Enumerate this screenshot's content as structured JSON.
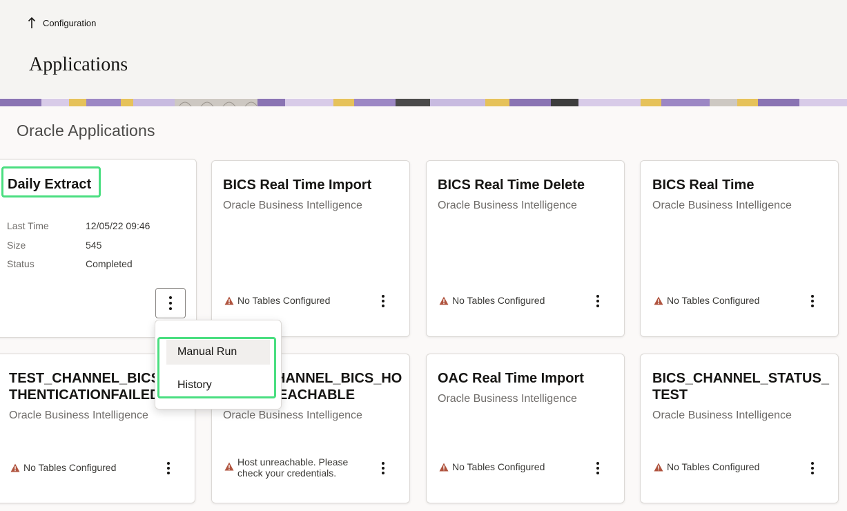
{
  "header": {
    "back_label": "Configuration",
    "page_title": "Applications"
  },
  "section": {
    "title": "Oracle Applications"
  },
  "featured_card": {
    "title": "Daily Extract",
    "rows": [
      {
        "label": "Last Time",
        "value": "12/05/22 09:46"
      },
      {
        "label": "Size",
        "value": "545"
      },
      {
        "label": "Status",
        "value": "Completed"
      }
    ]
  },
  "cards": [
    {
      "title": "BICS Real Time Import",
      "subtitle": "Oracle Business Intelligence",
      "status": "No Tables Configured"
    },
    {
      "title": "BICS Real Time Delete",
      "subtitle": "Oracle Business Intelligence",
      "status": "No Tables Configured"
    },
    {
      "title": "BICS Real Time",
      "subtitle": "Oracle Business Intelligence",
      "status": "No Tables Configured"
    },
    {
      "title": "TEST_CHANNEL_BICS_AUTHENTICATIONFAILED",
      "subtitle": "Oracle Business Intelligence",
      "status": "No Tables Configured"
    },
    {
      "title": "TEST_CHANNEL_BICS_HOSTUNREACHABLE",
      "subtitle": "Oracle Business Intelligence",
      "status": "Host unreachable. Please check your credentials."
    },
    {
      "title": "OAC Real Time Import",
      "subtitle": "Oracle Business Intelligence",
      "status": "No Tables Configured"
    },
    {
      "title": "BICS_CHANNEL_STATUS_TEST",
      "subtitle": "Oracle Business Intelligence",
      "status": "No Tables Configured"
    }
  ],
  "card_title_lines": {
    "c3": [
      "TEST_CHANNEL_BICS_",
      "THENTICATIONFAILED"
    ],
    "c4": [
      "HANNEL_BICS_HO",
      "EACHABLE"
    ],
    "c6": [
      "BICS_CHANNEL_STATUS_",
      "TEST"
    ]
  },
  "status_lines": {
    "c4": [
      "Host unreachable. Please",
      "check your credentials."
    ]
  },
  "menu": {
    "items": [
      "Manual Run",
      "History"
    ]
  },
  "colors": {
    "highlight": "#4ade80",
    "warning": "#b0543f"
  },
  "icons": {
    "back": "arrow-up-icon",
    "warning": "warning-triangle-icon",
    "more": "kebab-menu-icon"
  }
}
